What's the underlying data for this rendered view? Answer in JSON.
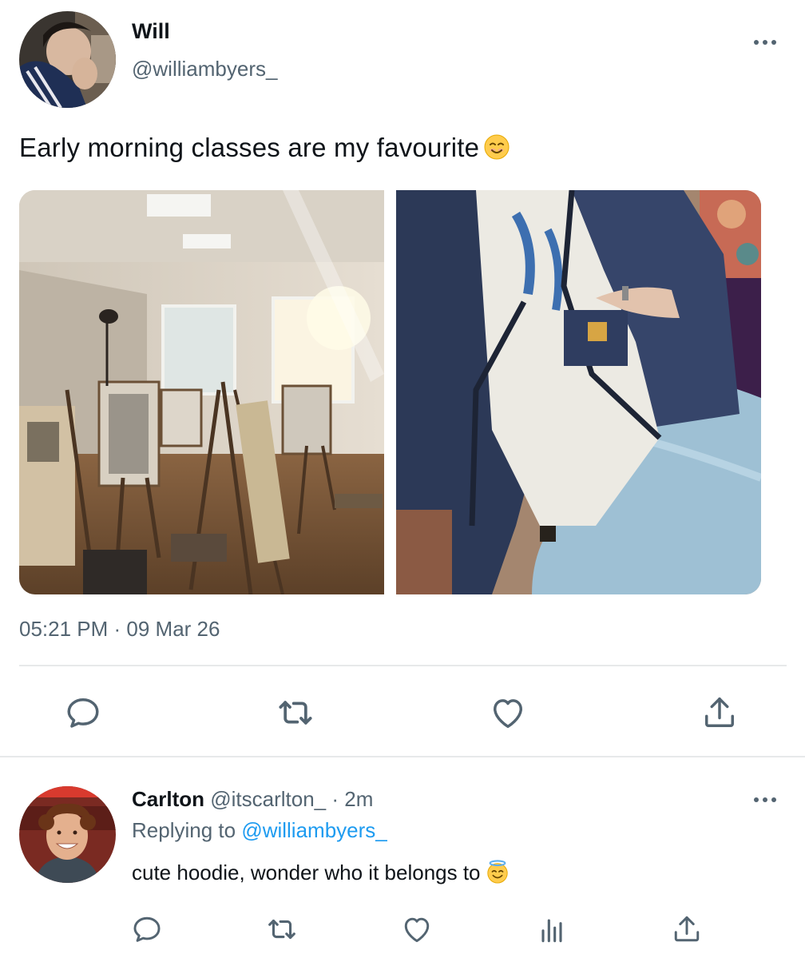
{
  "tweet": {
    "author_name": "Will",
    "author_handle": "@williambyers_",
    "text": "Early morning classes are my favourite",
    "text_emoji": "smiling-face-emoji",
    "timestamp": "05:21 PM · 09 Mar 26",
    "media": [
      "art-classroom-photo",
      "navy-jacket-photo"
    ],
    "actions": [
      {
        "name": "reply",
        "icon": "reply-icon"
      },
      {
        "name": "retweet",
        "icon": "retweet-icon"
      },
      {
        "name": "like",
        "icon": "heart-icon"
      },
      {
        "name": "share",
        "icon": "share-icon"
      }
    ]
  },
  "reply": {
    "author_name": "Carlton",
    "author_handle": "@itscarlton_",
    "separator": " · ",
    "time": "2m",
    "replying_prefix": "Replying to ",
    "replying_to": "@williambyers_",
    "text": "cute hoodie, wonder who it belongs to",
    "text_emoji": "smiling-face-with-halo-emoji",
    "actions": [
      {
        "name": "reply",
        "icon": "reply-icon"
      },
      {
        "name": "retweet",
        "icon": "retweet-icon"
      },
      {
        "name": "like",
        "icon": "heart-icon"
      },
      {
        "name": "views",
        "icon": "analytics-icon"
      },
      {
        "name": "share",
        "icon": "share-icon"
      }
    ]
  },
  "colors": {
    "text_primary": "#0f1419",
    "text_secondary": "#536471",
    "link": "#1d9bf0",
    "divider": "#e7e9ea"
  }
}
